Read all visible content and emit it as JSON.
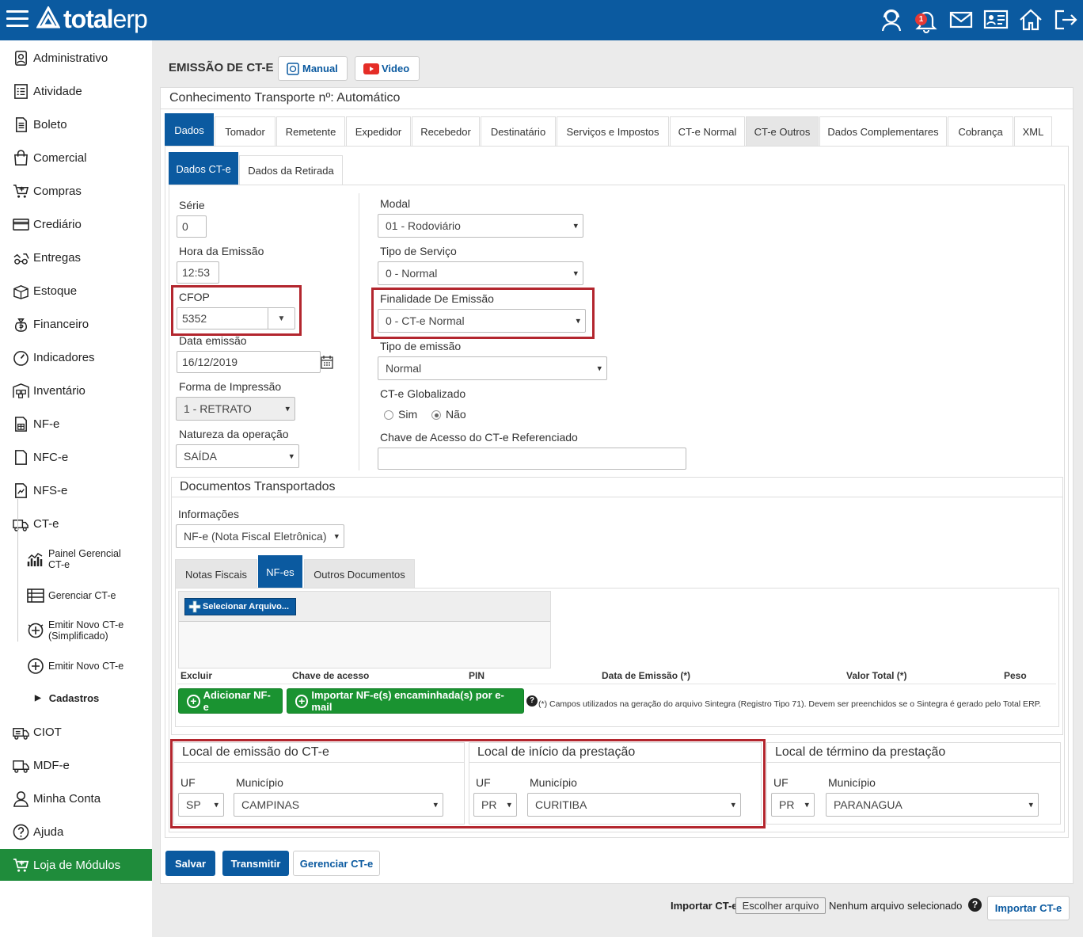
{
  "header": {
    "logo_a": "total",
    "logo_b": "erp",
    "notif_count": "1"
  },
  "sidebar": {
    "items": [
      {
        "label": "Administrativo",
        "icon": "admin-icon"
      },
      {
        "label": "Atividade",
        "icon": "activity-icon"
      },
      {
        "label": "Boleto",
        "icon": "boleto-icon"
      },
      {
        "label": "Comercial",
        "icon": "bag-icon"
      },
      {
        "label": "Compras",
        "icon": "cart-icon"
      },
      {
        "label": "Crediário",
        "icon": "card-icon"
      },
      {
        "label": "Entregas",
        "icon": "delivery-icon"
      },
      {
        "label": "Estoque",
        "icon": "box-icon"
      },
      {
        "label": "Financeiro",
        "icon": "money-bag-icon"
      },
      {
        "label": "Indicadores",
        "icon": "gauge-icon"
      },
      {
        "label": "Inventário",
        "icon": "inventory-icon"
      },
      {
        "label": "NF-e",
        "icon": "nfe-icon"
      },
      {
        "label": "NFC-e",
        "icon": "document-icon"
      },
      {
        "label": "NFS-e",
        "icon": "nfse-icon"
      },
      {
        "label": "CT-e",
        "icon": "truck-doc-icon"
      }
    ],
    "subitems": [
      {
        "label": "Painel Gerencial CT-e"
      },
      {
        "label": "Gerenciar CT-e"
      },
      {
        "label": "Emitir Novo CT-e (Simplificado)"
      },
      {
        "label": "Emitir Novo CT-e"
      },
      {
        "label": "Cadastros"
      }
    ],
    "items2": [
      {
        "label": "CIOT"
      },
      {
        "label": "MDF-e"
      },
      {
        "label": "Minha Conta"
      },
      {
        "label": "Ajuda"
      }
    ],
    "store": "Loja de Módulos"
  },
  "page": {
    "title": "EMISSÃO DE CT-E",
    "manual": "Manual",
    "video": "Video",
    "subtitle": "Conhecimento Transporte nº: Automático"
  },
  "tabs": [
    "Dados",
    "Tomador",
    "Remetente",
    "Expedidor",
    "Recebedor",
    "Destinatário",
    "Serviços e Impostos",
    "CT-e Normal",
    "CT-e Outros",
    "Dados Complementares",
    "Cobrança",
    "XML"
  ],
  "subtabs": [
    "Dados CT-e",
    "Dados da Retirada"
  ],
  "form": {
    "serie_label": "Série",
    "serie": "0",
    "hora_label": "Hora da Emissão",
    "hora": "12:53",
    "cfop_label": "CFOP",
    "cfop": "5352",
    "data_label": "Data emissão",
    "data": "16/12/2019",
    "forma_label": "Forma de Impressão",
    "forma": "1 - RETRATO",
    "natureza_label": "Natureza da operação",
    "natureza": "SAÍDA",
    "modal_label": "Modal",
    "modal": "01 - Rodoviário",
    "servico_label": "Tipo de Serviço",
    "servico": "0 - Normal",
    "finalidade_label": "Finalidade De Emissão",
    "finalidade": "0 - CT-e Normal",
    "tipo_label": "Tipo de emissão",
    "tipo": "Normal",
    "global_label": "CT-e Globalizado",
    "sim": "Sim",
    "nao": "Não",
    "chave_label": "Chave de Acesso do CT-e Referenciado",
    "chave": ""
  },
  "docs": {
    "title": "Documentos Transportados",
    "info_label": "Informações",
    "info": "NF-e (Nota Fiscal Eletrônica)",
    "tabs": [
      "Notas Fiscais",
      "NF-es",
      "Outros Documentos"
    ],
    "select_file": "Selecionar Arquivo...",
    "cols": [
      "Excluir",
      "Chave de acesso",
      "PIN",
      "Data de Emissão (*)",
      "Valor Total (*)",
      "Peso"
    ],
    "add": "Adicionar NF-e",
    "import": "Importar NF-e(s) encaminhada(s) por e-mail",
    "note": "(*) Campos utilizados na geração do arquivo Sintegra (Registro Tipo 71). Devem ser preenchidos se o Sintegra é gerado pelo Total ERP."
  },
  "locais": [
    {
      "title": "Local de emissão do CT-e",
      "uf_label": "UF",
      "uf": "SP",
      "mun_label": "Município",
      "mun": "CAMPINAS"
    },
    {
      "title": "Local de início da prestação",
      "uf_label": "UF",
      "uf": "PR",
      "mun_label": "Município",
      "mun": "CURITIBA"
    },
    {
      "title": "Local de término da prestação",
      "uf_label": "UF",
      "uf": "PR",
      "mun_label": "Município",
      "mun": "PARANAGUA"
    }
  ],
  "actions": {
    "salvar": "Salvar",
    "transmitir": "Transmitir",
    "gerenciar": "Gerenciar CT-e"
  },
  "footer": {
    "import_label": "Importar CT-e:",
    "choose": "Escolher arquivo",
    "none": "Nenhum arquivo selecionado",
    "import_btn": "Importar CT-e"
  }
}
